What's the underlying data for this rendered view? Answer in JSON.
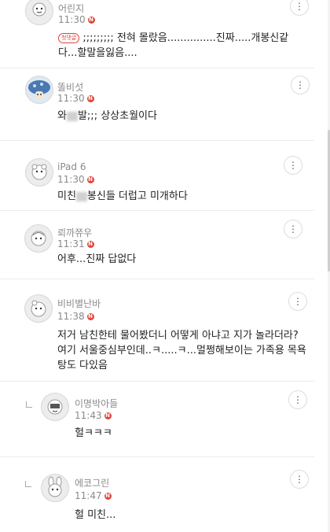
{
  "comments": [
    {
      "nick": "어린지",
      "time": "11:30",
      "new": "N",
      "badge": "첫댓글",
      "text": ";;;;;;;;; 전혀 몰랐음...............진짜.....개봉신같다...할말을잃음...."
    },
    {
      "nick": "똘비섯",
      "time": "11:30",
      "new": "N",
      "text_a": "와",
      "text_b": "발;;; 상상초월이다"
    },
    {
      "nick": "iPad 6",
      "time": "11:30",
      "new": "N",
      "text_a": "미친",
      "text_b": "봉신들 더럽고 미개하다"
    },
    {
      "nick": "뢰까쮸우",
      "time": "11:31",
      "new": "N",
      "text": "어후...진짜 답없다"
    },
    {
      "nick": "비비별난바",
      "time": "11:38",
      "new": "N",
      "text": "저거 남친한테 물어봤더니 어떻게 아냐고 지가 놀라더라?여기 서울중심부인데..ㅋ.....ㅋ...멀쩡해보이는 가족용 목욕탕도 다있음"
    },
    {
      "nick": "이명박아들",
      "time": "11:43",
      "new": "N",
      "text": "헐ㅋㅋㅋ"
    },
    {
      "nick": "에코그린",
      "time": "11:47",
      "new": "N",
      "text": "헐 미친..."
    }
  ],
  "menu_icon": "⋮",
  "icons": {
    "menu": "more-vertical-icon",
    "reply": "reply-arrow-icon"
  }
}
